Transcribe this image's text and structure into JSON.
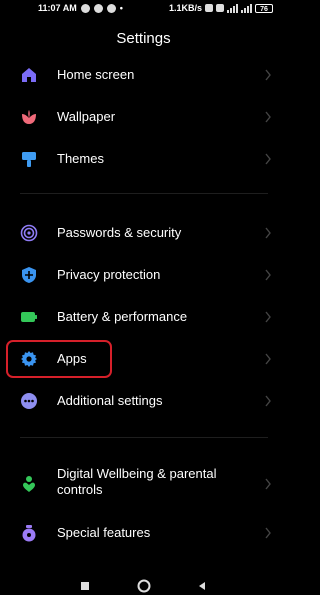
{
  "status_bar": {
    "time": "11:07 AM",
    "speed": "1.1KB/s",
    "battery": "76"
  },
  "header": {
    "title": "Settings"
  },
  "sections": [
    {
      "items": [
        {
          "label": "Home screen",
          "icon": "home-icon",
          "color": "#7b6cf6"
        },
        {
          "label": "Wallpaper",
          "icon": "wallpaper-icon",
          "color": "#f06a7a"
        },
        {
          "label": "Themes",
          "icon": "themes-icon",
          "color": "#3f9cf2"
        }
      ]
    },
    {
      "items": [
        {
          "label": "Passwords & security",
          "icon": "fingerprint-icon",
          "color": "#8f7cf6"
        },
        {
          "label": "Privacy protection",
          "icon": "privacy-shield-icon",
          "color": "#3a94f0"
        },
        {
          "label": "Battery & performance",
          "icon": "battery-icon",
          "color": "#34c759"
        },
        {
          "label": "Apps",
          "icon": "gear-icon",
          "color": "#3a94f0",
          "highlighted": true
        },
        {
          "label": "Additional settings",
          "icon": "more-dots-icon",
          "color": "#8e8ef0"
        }
      ]
    },
    {
      "items": [
        {
          "label": "Digital Wellbeing & parental controls",
          "icon": "wellbeing-icon",
          "color": "#34c759"
        },
        {
          "label": "Special features",
          "icon": "special-features-icon",
          "color": "#9b7bf5"
        }
      ]
    }
  ],
  "colors": {
    "background": "#000000",
    "highlight_border": "#d6202a"
  }
}
